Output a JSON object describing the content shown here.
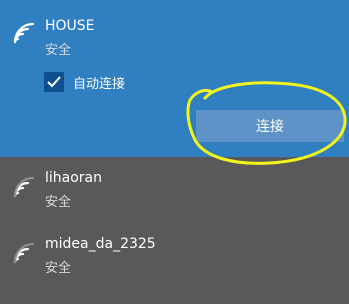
{
  "networks": [
    {
      "name": "HOUSE",
      "status": "安全",
      "auto_connect_label": "自动连接",
      "auto_connect_checked": true,
      "connect_label": "连接",
      "selected": true,
      "icon": "wifi-icon"
    },
    {
      "name": "lihaoran",
      "status": "安全",
      "selected": false,
      "icon": "wifi-icon"
    },
    {
      "name": "midea_da_2325",
      "status": "安全",
      "selected": false,
      "icon": "wifi-icon"
    }
  ],
  "colors": {
    "selected_bg": "#2f7fc1",
    "panel_bg": "#5a5858",
    "button_bg": "#5d93c6",
    "annotation": "#f2f51a"
  }
}
